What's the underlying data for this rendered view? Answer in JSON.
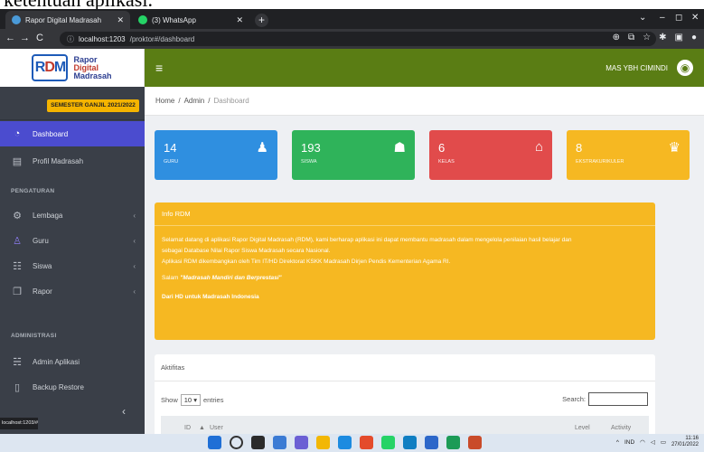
{
  "caption": {
    "text": "ketentuan aplikasi."
  },
  "browser": {
    "tabs": [
      {
        "label": "Rapor Digital Madrasah",
        "active": true
      },
      {
        "label": "(3) WhatsApp",
        "active": false
      }
    ],
    "url_host": "localhost:1203",
    "url_path": "/proktor#/dashboard",
    "status_url": "localhost:1203/#"
  },
  "logo": {
    "line1": "Rapor",
    "line2": "Digital",
    "line3": "Madrasah"
  },
  "header": {
    "user_name": "MAS YBH CIMINDI"
  },
  "sidebar": {
    "semester": "SEMESTER GANJIL 2021/2022",
    "items": [
      {
        "label": "Dashboard",
        "icon": "dashboard-icon"
      },
      {
        "label": "Profil Madrasah",
        "icon": "building-icon"
      }
    ],
    "section1": "PENGATURAN",
    "settings": [
      {
        "label": "Lembaga",
        "icon": "cogs-icon"
      },
      {
        "label": "Guru",
        "icon": "user-icon"
      },
      {
        "label": "Siswa",
        "icon": "users-icon"
      },
      {
        "label": "Rapor",
        "icon": "copy-icon"
      }
    ],
    "section2": "ADMINISTRASI",
    "admin": [
      {
        "label": "Admin Aplikasi",
        "icon": "users-cog-icon"
      },
      {
        "label": "Backup Restore",
        "icon": "file-icon"
      }
    ]
  },
  "breadcrumb": {
    "home": "Home",
    "sep": "/",
    "admin": "Admin",
    "current": "Dashboard"
  },
  "stats": [
    {
      "value": "14",
      "label": "GURU",
      "color": "#2f8fe0",
      "icon": "user-icon"
    },
    {
      "value": "193",
      "label": "SISWA",
      "color": "#2fb35a",
      "icon": "users-icon"
    },
    {
      "value": "6",
      "label": "KELAS",
      "color": "#e14b4b",
      "icon": "bank-icon"
    },
    {
      "value": "8",
      "label": "EKSTRAKURIKULER",
      "color": "#f6b822",
      "icon": "trophy-icon"
    }
  ],
  "info": {
    "title": "Info RDM",
    "p1": "Selamat datang di aplikasi Rapor Digital Madrasah (RDM), kami berharap aplikasi ini dapat membantu madrasah dalam mengelola penilaian hasil belajar dan",
    "p2": "sebagai Database Nilai Rapor Siswa Madrasah secara Nasional.",
    "p3": "Aplikasi RDM dikembangkan oleh Tim IT/HD Direktorat KSKK Madrasah Dirjen Pendis Kementerian Agama RI.",
    "motto_prefix": "Salam",
    "motto": "\"Madrasah Mandiri dan Berprestasi\"",
    "closing": "Dari HD untuk Madrasah Indonesia"
  },
  "activity": {
    "title": "Aktifitas",
    "show_label": "Show",
    "entries_value": "10",
    "entries_label": "entries",
    "search_label": "Search:",
    "col_id": "ID",
    "col_user": "User",
    "col_level": "Level",
    "col_activity": "Activity"
  },
  "taskbar": {
    "lang": "IND",
    "time": "11:16",
    "date": "27/01/2022"
  }
}
